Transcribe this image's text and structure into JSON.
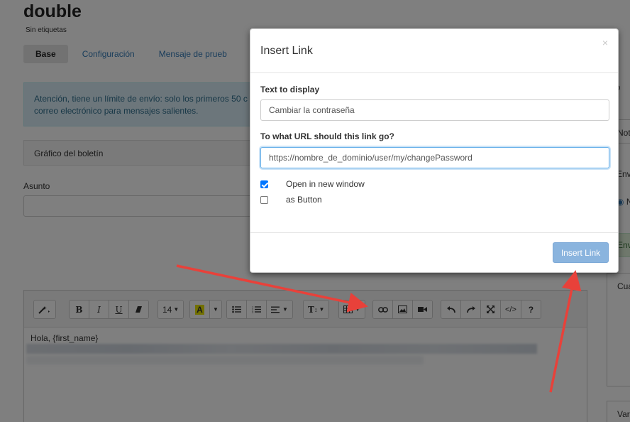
{
  "page": {
    "title": "double",
    "subtitle": "Sin etiquetas",
    "tabs": [
      {
        "label": "Base"
      },
      {
        "label": "Configuración"
      },
      {
        "label": "Mensaje de prueb"
      }
    ],
    "alert_text": "Atención, tiene un límite de envío: solo los primeros 50 c correo electrónico para mensajes salientes.",
    "panel_heading": "Gráfico del boletín",
    "subject_label": "Asunto",
    "right_column": [
      "nsp",
      "teg",
      "Not",
      "Env",
      "N",
      "Env",
      "Cua",
      "Var"
    ]
  },
  "editor": {
    "toolbar": {
      "font_size": "14",
      "buttons": [
        "magic-icon",
        "bold-icon",
        "italic-icon",
        "underline-icon",
        "eraser-icon",
        "font-size",
        "color-icon",
        "unordered-list-icon",
        "ordered-list-icon",
        "align-icon",
        "text-height-icon",
        "table-icon",
        "link-icon",
        "image-icon",
        "video-icon",
        "undo-icon",
        "redo-icon",
        "fullscreen-icon",
        "code-icon",
        "help-icon"
      ]
    },
    "body_text": "Hola, {first_name}"
  },
  "modal": {
    "title": "Insert Link",
    "close_label": "×",
    "text_label": "Text to display",
    "text_value": "Cambiar la contraseña",
    "url_label": "To what URL should this link go?",
    "url_value": "https://nombre_de_dominio/user/my/changePassword",
    "new_window_label": "Open in new window",
    "new_window_checked": true,
    "as_button_label": "as Button",
    "as_button_checked": false,
    "submit_label": "Insert Link"
  },
  "colors": {
    "primary": "#8ab4de",
    "annotation_arrow": "#e8413a",
    "alert_bg": "#d9edf7"
  }
}
